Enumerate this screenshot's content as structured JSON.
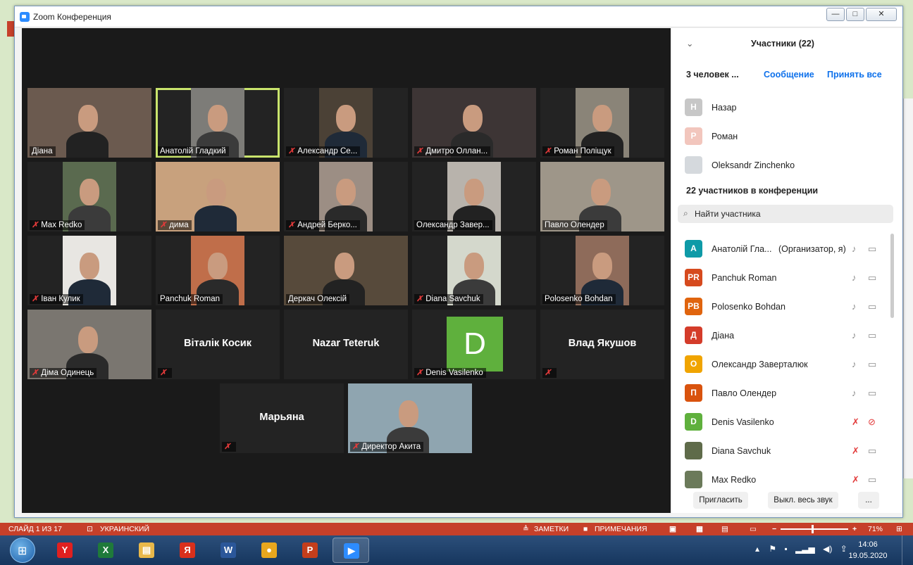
{
  "window": {
    "title": "Zoom Конференция",
    "min": "—",
    "max": "□",
    "close": "✕"
  },
  "tiles": [
    {
      "name": "Діана",
      "muted": false,
      "bg": "#6b5a4f"
    },
    {
      "name": "Анатолій Гладкий",
      "muted": false,
      "bg": "#7d7c78",
      "highlight": true
    },
    {
      "name": "Александр Се...",
      "muted": true,
      "bg": "#4b4136"
    },
    {
      "name": "Дмитро Оллан...",
      "muted": true,
      "bg": "#3d3535"
    },
    {
      "name": "Роман Поліщук",
      "muted": true,
      "bg": "#8a8478"
    },
    {
      "name": "Max Redko",
      "muted": true,
      "bg": "#5a6a4f"
    },
    {
      "name": "дима",
      "muted": true,
      "bg": "#c8a17d"
    },
    {
      "name": "Андрей Берко...",
      "muted": true,
      "bg": "#9c8e84"
    },
    {
      "name": "Олександр Завер...",
      "muted": false,
      "bg": "#b8b3ac"
    },
    {
      "name": "Павло Олендер",
      "muted": false,
      "bg": "#9e9689"
    },
    {
      "name": "Іван Кулик",
      "muted": true,
      "bg": "#e8e6e2"
    },
    {
      "name": "Panchuk Roman",
      "muted": false,
      "bg": "#c06e4a"
    },
    {
      "name": "Деркач Олексій",
      "muted": false,
      "bg": "#574a3b"
    },
    {
      "name": "Diana Savchuk",
      "muted": true,
      "bg": "#d4d8cc"
    },
    {
      "name": "Polosenko Bohdan",
      "muted": false,
      "bg": "#8e6b5a"
    },
    {
      "name": "Діма Одинець",
      "muted": true,
      "bg": "#7a7670"
    },
    {
      "name": "Віталік Косик",
      "muted": true,
      "bg": ""
    },
    {
      "name": "Nazar Teteruk",
      "muted": false,
      "bg": ""
    },
    {
      "name": "Denis Vasilenko",
      "muted": true,
      "bg": "",
      "avatar": "D"
    },
    {
      "name": "Влад Якушов",
      "muted": true,
      "bg": ""
    },
    {
      "name": "Марьяна",
      "muted": true,
      "bg": ""
    },
    {
      "name": "Директор Акита",
      "muted": true,
      "bg": "#8fa5b0"
    }
  ],
  "panel": {
    "title": "Участники (22)",
    "waiting": "3 человек ...",
    "message": "Сообщение",
    "admit_all": "Принять все",
    "waiting_list": [
      {
        "initial": "Н",
        "name": "Назар",
        "color": "#c7c7c7"
      },
      {
        "initial": "Р",
        "name": "Роман",
        "color": "#f2c6bd"
      },
      {
        "initial": "",
        "name": "Oleksandr Zinchenko",
        "color": "#d5d9dd"
      }
    ],
    "in_meeting": "22 участников в конференции",
    "search_placeholder": "Найти участника",
    "participants": [
      {
        "initial": "А",
        "name": "Анатолій Гла...",
        "role": "(Организатор, я)",
        "color": "#0e9aa7",
        "muted": false,
        "video_off": false
      },
      {
        "initial": "PR",
        "name": "Panchuk Roman",
        "role": "",
        "color": "#d64a1e",
        "muted": false,
        "video_off": false
      },
      {
        "initial": "PB",
        "name": "Polosenko Bohdan",
        "role": "",
        "color": "#e0640e",
        "muted": false,
        "video_off": false
      },
      {
        "initial": "Д",
        "name": "Діана",
        "role": "",
        "color": "#d43c2a",
        "muted": false,
        "video_off": false
      },
      {
        "initial": "О",
        "name": "Олександр Заверталюк",
        "role": "",
        "color": "#f0a400",
        "muted": false,
        "video_off": false
      },
      {
        "initial": "П",
        "name": "Павло Олендер",
        "role": "",
        "color": "#d9530e",
        "muted": false,
        "video_off": false
      },
      {
        "initial": "D",
        "name": "Denis Vasilenko",
        "role": "",
        "color": "#5fb03d",
        "muted": true,
        "video_off": true
      },
      {
        "initial": "",
        "name": "Diana Savchuk",
        "role": "",
        "color": "#5f6b4a",
        "muted": true,
        "video_off": false
      },
      {
        "initial": "",
        "name": "Max Redko",
        "role": "",
        "color": "#6b7a5a",
        "muted": true,
        "video_off": false
      }
    ],
    "invite": "Пригласить",
    "mute_all": "Выкл. весь звук",
    "more": "..."
  },
  "ppt_status": {
    "slide": "СЛАЙД 1 ИЗ 17",
    "lang": "УКРАИНСКИЙ",
    "notes": "ЗАМЕТКИ",
    "comments": "ПРИМЕЧАНИЯ",
    "zoom": "71%",
    "minus": "−",
    "plus": "+"
  },
  "taskbar": {
    "apps": [
      {
        "label": "Y",
        "color": "#e02020",
        "name": "yandex-browser"
      },
      {
        "label": "X",
        "color": "#1f7a3a",
        "name": "excel"
      },
      {
        "label": "▤",
        "color": "#e8b84a",
        "name": "file-explorer"
      },
      {
        "label": "Я",
        "color": "#d9301c",
        "name": "yandex"
      },
      {
        "label": "W",
        "color": "#2b579a",
        "name": "word"
      },
      {
        "label": "●",
        "color": "#e8a71e",
        "name": "chrome"
      },
      {
        "label": "P",
        "color": "#c43e1c",
        "name": "powerpoint"
      },
      {
        "label": "▶",
        "color": "#2d8cff",
        "name": "zoom"
      }
    ],
    "time": "14:06",
    "date": "19.05.2020"
  }
}
